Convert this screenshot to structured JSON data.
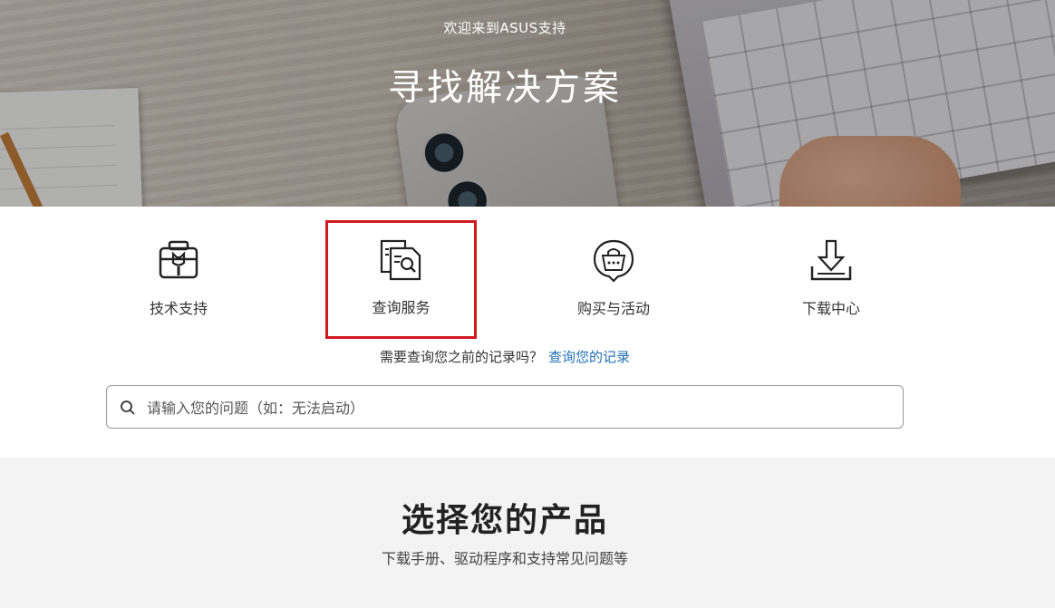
{
  "hero": {
    "welcome": "欢迎来到ASUS支持",
    "title": "寻找解决方案"
  },
  "services": [
    {
      "label": "技术支持",
      "icon": "tech-support-icon"
    },
    {
      "label": "查询服务",
      "icon": "inquiry-service-icon"
    },
    {
      "label": "购买与活动",
      "icon": "purchase-events-icon"
    },
    {
      "label": "下载中心",
      "icon": "download-icon"
    }
  ],
  "records": {
    "prompt": "需要查询您之前的记录吗？",
    "link": "查询您的记录"
  },
  "search": {
    "placeholder": "请输入您的问题（如：无法启动）"
  },
  "products": {
    "title": "选择您的产品",
    "subtitle": "下载手册、驱动程序和支持常见问题等"
  },
  "colors": {
    "highlight": "#d0191f",
    "link": "#1f6fb5",
    "section_bg": "#f3f3f3"
  }
}
